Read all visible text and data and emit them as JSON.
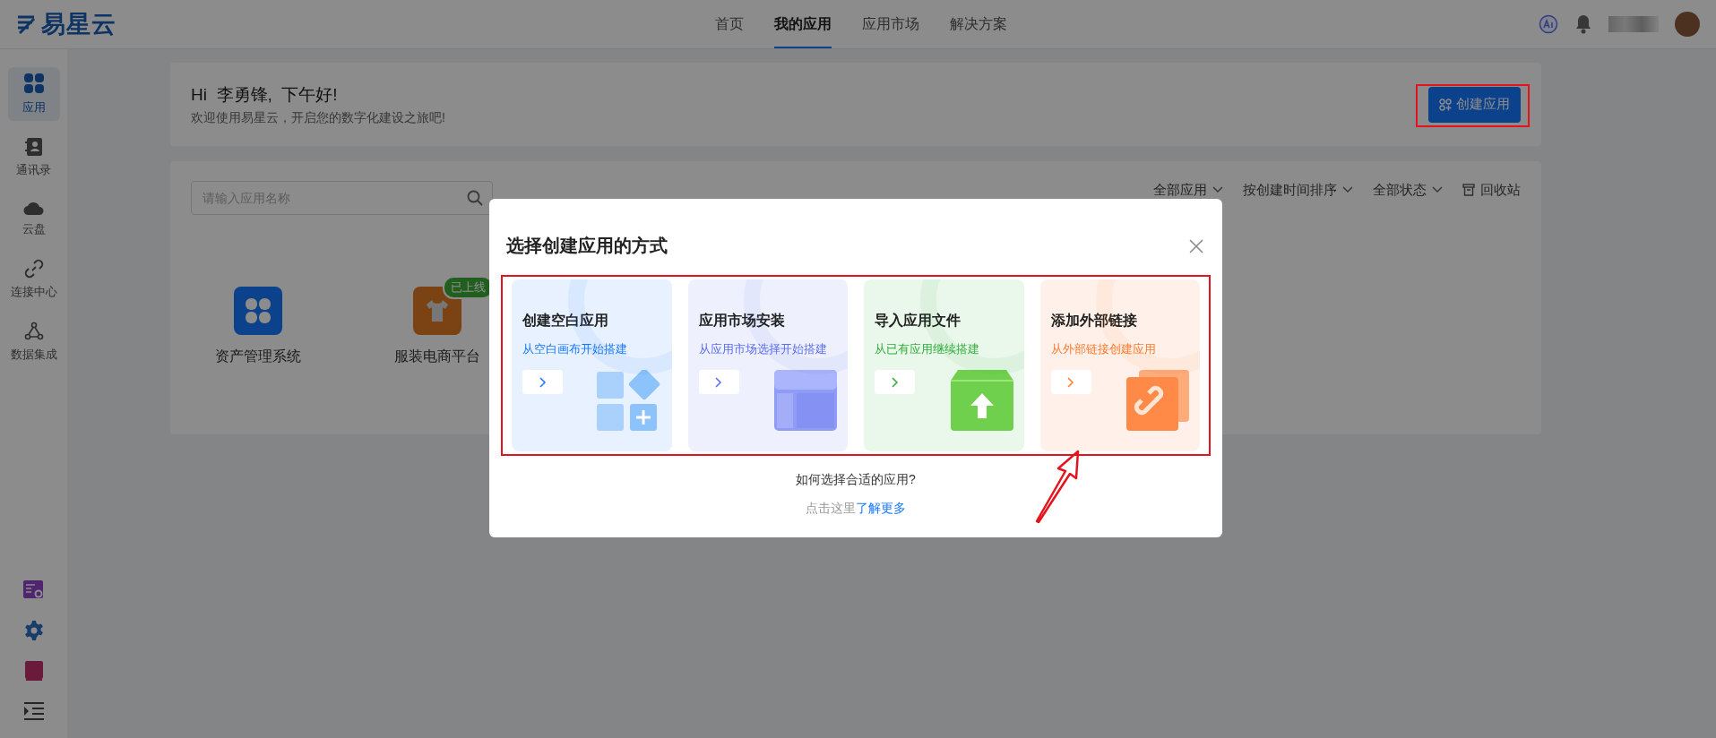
{
  "logo": {
    "text": "易星云"
  },
  "nav": [
    {
      "label": "首页",
      "selected": false
    },
    {
      "label": "我的应用",
      "selected": true
    },
    {
      "label": "应用市场",
      "selected": false
    },
    {
      "label": "解决方案",
      "selected": false
    }
  ],
  "sidebar": {
    "items": [
      {
        "label": "应用",
        "kind": "apps",
        "selected": true
      },
      {
        "label": "通讯录",
        "kind": "contacts",
        "selected": false
      },
      {
        "label": "云盘",
        "kind": "cloud",
        "selected": false
      },
      {
        "label": "连接中心",
        "kind": "link",
        "selected": false
      },
      {
        "label": "数据集成",
        "kind": "integration",
        "selected": false
      }
    ]
  },
  "greeting": {
    "title": "Hi  李勇锋,  下午好!",
    "subtitle": "欢迎使用易星云，开启您的数字化建设之旅吧!"
  },
  "create_button": "创建应用",
  "search": {
    "placeholder": "请输入应用名称"
  },
  "filters": [
    "全部应用",
    "按创建时间排序",
    "全部状态"
  ],
  "recycle_bin": "回收站",
  "apps": [
    {
      "name": "资产管理系统",
      "kind": "grid"
    },
    {
      "name": "服装电商平台",
      "kind": "shirt",
      "badge": "已上线"
    }
  ],
  "dialog": {
    "title": "选择创建应用的方式",
    "options": [
      {
        "title": "创建空白应用",
        "subtitle": "从空白画布开始搭建",
        "kind": "blank",
        "color": "#1677ff"
      },
      {
        "title": "应用市场安装",
        "subtitle": "从应用市场选择开始搭建",
        "kind": "market",
        "color": "#5b6cf0"
      },
      {
        "title": "导入应用文件",
        "subtitle": "从已有应用继续搭建",
        "kind": "import",
        "color": "#2fae3a"
      },
      {
        "title": "添加外部链接",
        "subtitle": "从外部链接创建应用",
        "kind": "link",
        "color": "#ff7a2e"
      }
    ],
    "question": "如何选择合适的应用?",
    "link_prefix": "点击这里",
    "link": "了解更多"
  }
}
